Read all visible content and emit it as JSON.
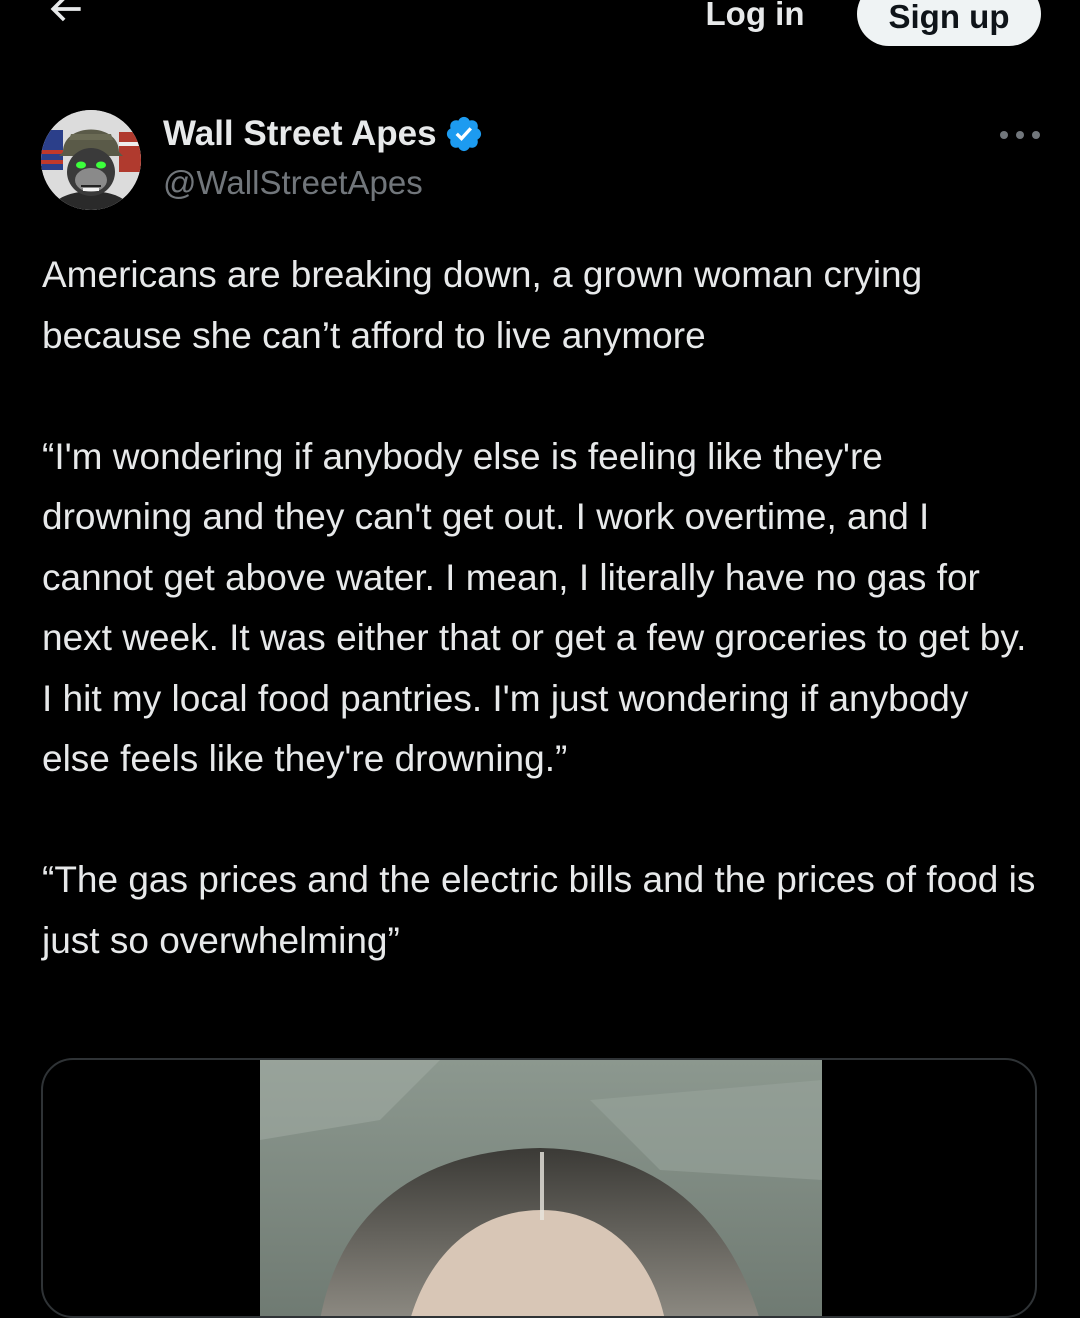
{
  "topbar": {
    "back_icon": "arrow-left-icon",
    "login_label": "Log in",
    "signup_label": "Sign up"
  },
  "author": {
    "display_name": "Wall Street Apes",
    "handle": "@WallStreetApes",
    "verified_icon": "verified-badge-icon",
    "verified_color": "#1d9bf0",
    "more_icon": "more-horizontal-icon"
  },
  "tweet": {
    "paragraphs": [
      "Americans are breaking down, a grown woman crying because she can’t afford to live anymore",
      "“I'm wondering if anybody else is feeling like they're drowning and they can't get out. I work overtime, and I cannot get above water. I mean, I literally have no gas for next week. It was either that or get a few groceries to get by. I hit my local food pantries. I'm just wondering if anybody else feels like they're drowning.”",
      "“The gas prices and the electric bills and the prices of food is just so overwhelming”"
    ]
  },
  "media": {
    "type": "video-thumbnail"
  },
  "colors": {
    "background": "#000000",
    "text": "#e7e9ea",
    "muted": "#71767b",
    "border": "#2f3336",
    "signup_bg": "#eff3f4"
  }
}
